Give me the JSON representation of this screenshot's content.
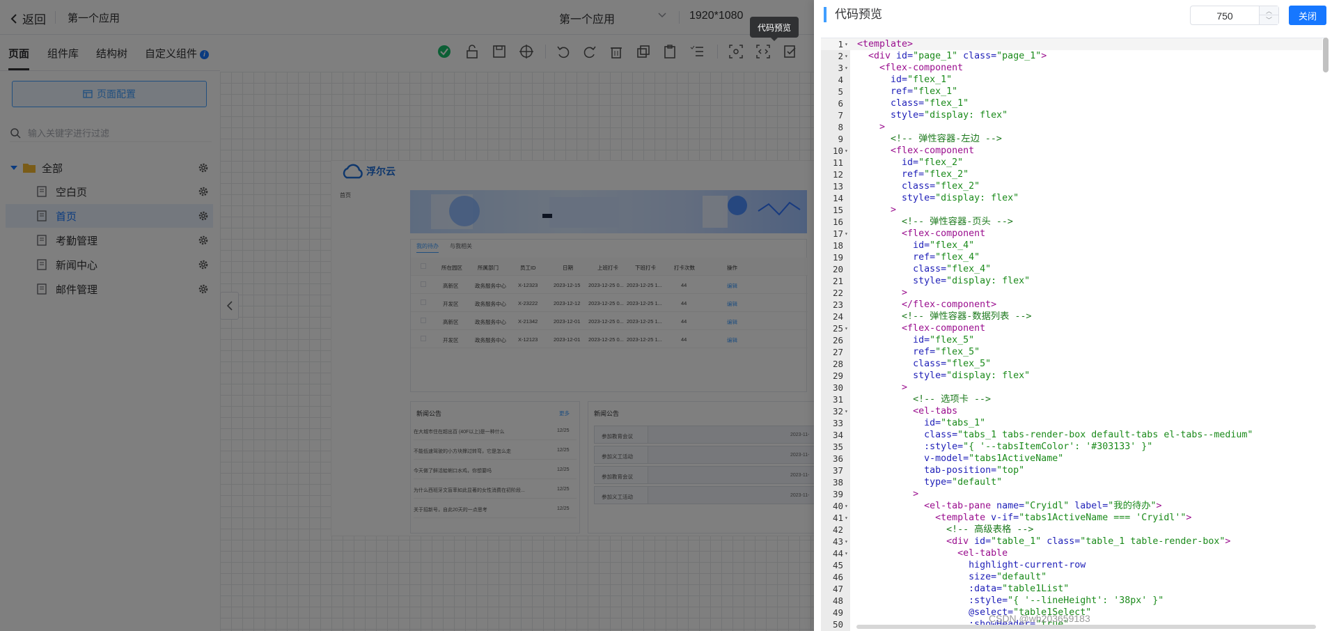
{
  "topbar": {
    "back_label": "返回",
    "app_name": "第一个应用",
    "center_app_select": "第一个应用",
    "resolution": "1920*1080"
  },
  "left_tabs": [
    "页面",
    "组件库",
    "结构树",
    "自定义组件"
  ],
  "left_panel": {
    "page_config_label": "页面配置",
    "filter_placeholder": "输入关键字进行过滤",
    "tree_root": "全部",
    "tree_items": [
      "空白页",
      "首页",
      "考勤管理",
      "新闻中心",
      "邮件管理"
    ],
    "active_item": "首页"
  },
  "tooltip": "代码预览",
  "preview": {
    "logo": "浮尔云",
    "home_label": "首页",
    "tabs": [
      "我的待办",
      "与我相关"
    ],
    "table_headers": [
      "所在园区",
      "所属部门",
      "员工ID",
      "日期",
      "上班打卡",
      "下班打卡",
      "打卡次数",
      "操作"
    ],
    "table_rows": [
      [
        "高新区",
        "政务服务中心",
        "X-12323",
        "2023-12-15",
        "2023-12-25 0...",
        "2023-12-25 1...",
        "44",
        "编辑"
      ],
      [
        "开发区",
        "政务服务中心",
        "X-23222",
        "2023-12-12",
        "2023-12-25 0...",
        "2023-12-25 1...",
        "44",
        "编辑"
      ],
      [
        "高新区",
        "政务服务中心",
        "X-21342",
        "2023-12-01",
        "2023-12-25 0...",
        "2023-12-25 1...",
        "44",
        "编辑"
      ],
      [
        "开发区",
        "政务服务中心",
        "X-12123",
        "2023-12-01",
        "2023-12-25 0...",
        "2023-12-25 1...",
        "44",
        "编辑"
      ]
    ],
    "news_title": "新闻公告",
    "news_more": "更多",
    "news_items": [
      [
        "在大城市住在超出百 (40F以上)是一种什么",
        "12/25"
      ],
      [
        "不能低速驾驶的小方块撑过转弯，它是怎么走",
        "12/25"
      ],
      [
        "今天做了鲜活蛤蜊口水鸡，你想要吗",
        "12/25"
      ],
      [
        "为什么西班牙文盲率如此显著的女性消费在初阶段...",
        "12/25"
      ],
      [
        "关于招新号，自此20天的一点思考",
        "12/25"
      ]
    ],
    "news2_title": "新闻公告",
    "news2_items": [
      "参加教育会议",
      "参加义工活动",
      "参加教育会议",
      "参加义工活动"
    ],
    "news2_date": "2023-11-"
  },
  "drawer": {
    "title": "代码预览",
    "width_value": "750",
    "close_label": "关闭"
  },
  "code_lines": [
    [
      [
        "tag",
        "<template>"
      ]
    ],
    [
      [
        "txt",
        "  "
      ],
      [
        "tag",
        "<div"
      ],
      [
        "attr",
        " id="
      ],
      [
        "str",
        "\"page_1\""
      ],
      [
        "attr",
        " class="
      ],
      [
        "str",
        "\"page_1\""
      ],
      [
        "tag",
        ">"
      ]
    ],
    [
      [
        "txt",
        "    "
      ],
      [
        "tag",
        "<flex-component"
      ]
    ],
    [
      [
        "txt",
        "      "
      ],
      [
        "attr",
        "id="
      ],
      [
        "str",
        "\"flex_1\""
      ]
    ],
    [
      [
        "txt",
        "      "
      ],
      [
        "attr",
        "ref="
      ],
      [
        "str",
        "\"flex_1\""
      ]
    ],
    [
      [
        "txt",
        "      "
      ],
      [
        "attr",
        "class="
      ],
      [
        "str",
        "\"flex_1\""
      ]
    ],
    [
      [
        "txt",
        "      "
      ],
      [
        "attr",
        "style="
      ],
      [
        "str",
        "\"display: flex\""
      ]
    ],
    [
      [
        "txt",
        "    "
      ],
      [
        "tag",
        ">"
      ]
    ],
    [
      [
        "txt",
        "      "
      ],
      [
        "com",
        "<!-- 弹性容器-左边 -->"
      ]
    ],
    [
      [
        "txt",
        "      "
      ],
      [
        "tag",
        "<flex-component"
      ]
    ],
    [
      [
        "txt",
        "        "
      ],
      [
        "attr",
        "id="
      ],
      [
        "str",
        "\"flex_2\""
      ]
    ],
    [
      [
        "txt",
        "        "
      ],
      [
        "attr",
        "ref="
      ],
      [
        "str",
        "\"flex_2\""
      ]
    ],
    [
      [
        "txt",
        "        "
      ],
      [
        "attr",
        "class="
      ],
      [
        "str",
        "\"flex_2\""
      ]
    ],
    [
      [
        "txt",
        "        "
      ],
      [
        "attr",
        "style="
      ],
      [
        "str",
        "\"display: flex\""
      ]
    ],
    [
      [
        "txt",
        "      "
      ],
      [
        "tag",
        ">"
      ]
    ],
    [
      [
        "txt",
        "        "
      ],
      [
        "com",
        "<!-- 弹性容器-页头 -->"
      ]
    ],
    [
      [
        "txt",
        "        "
      ],
      [
        "tag",
        "<flex-component"
      ]
    ],
    [
      [
        "txt",
        "          "
      ],
      [
        "attr",
        "id="
      ],
      [
        "str",
        "\"flex_4\""
      ]
    ],
    [
      [
        "txt",
        "          "
      ],
      [
        "attr",
        "ref="
      ],
      [
        "str",
        "\"flex_4\""
      ]
    ],
    [
      [
        "txt",
        "          "
      ],
      [
        "attr",
        "class="
      ],
      [
        "str",
        "\"flex_4\""
      ]
    ],
    [
      [
        "txt",
        "          "
      ],
      [
        "attr",
        "style="
      ],
      [
        "str",
        "\"display: flex\""
      ]
    ],
    [
      [
        "txt",
        "        "
      ],
      [
        "tag",
        ">"
      ]
    ],
    [
      [
        "txt",
        "        "
      ],
      [
        "tag",
        "</flex-component>"
      ]
    ],
    [
      [
        "txt",
        "        "
      ],
      [
        "com",
        "<!-- 弹性容器-数据列表 -->"
      ]
    ],
    [
      [
        "txt",
        "        "
      ],
      [
        "tag",
        "<flex-component"
      ]
    ],
    [
      [
        "txt",
        "          "
      ],
      [
        "attr",
        "id="
      ],
      [
        "str",
        "\"flex_5\""
      ]
    ],
    [
      [
        "txt",
        "          "
      ],
      [
        "attr",
        "ref="
      ],
      [
        "str",
        "\"flex_5\""
      ]
    ],
    [
      [
        "txt",
        "          "
      ],
      [
        "attr",
        "class="
      ],
      [
        "str",
        "\"flex_5\""
      ]
    ],
    [
      [
        "txt",
        "          "
      ],
      [
        "attr",
        "style="
      ],
      [
        "str",
        "\"display: flex\""
      ]
    ],
    [
      [
        "txt",
        "        "
      ],
      [
        "tag",
        ">"
      ]
    ],
    [
      [
        "txt",
        "          "
      ],
      [
        "com",
        "<!-- 选项卡 -->"
      ]
    ],
    [
      [
        "txt",
        "          "
      ],
      [
        "tag",
        "<el-tabs"
      ]
    ],
    [
      [
        "txt",
        "            "
      ],
      [
        "attr",
        "id="
      ],
      [
        "str",
        "\"tabs_1\""
      ]
    ],
    [
      [
        "txt",
        "            "
      ],
      [
        "attr",
        "class="
      ],
      [
        "str",
        "\"tabs_1 tabs-render-box default-tabs el-tabs--medium\""
      ]
    ],
    [
      [
        "txt",
        "            "
      ],
      [
        "attr",
        ":style="
      ],
      [
        "str",
        "\"{ '--tabsItemColor': '#303133' }\""
      ]
    ],
    [
      [
        "txt",
        "            "
      ],
      [
        "attr",
        "v-model="
      ],
      [
        "str",
        "\"tabs1ActiveName\""
      ]
    ],
    [
      [
        "txt",
        "            "
      ],
      [
        "attr",
        "tab-position="
      ],
      [
        "str",
        "\"top\""
      ]
    ],
    [
      [
        "txt",
        "            "
      ],
      [
        "attr",
        "type="
      ],
      [
        "str",
        "\"default\""
      ]
    ],
    [
      [
        "txt",
        "          "
      ],
      [
        "tag",
        ">"
      ]
    ],
    [
      [
        "txt",
        "            "
      ],
      [
        "tag",
        "<el-tab-pane"
      ],
      [
        "attr",
        " name="
      ],
      [
        "str",
        "\"Cryidl\""
      ],
      [
        "attr",
        " label="
      ],
      [
        "str",
        "\"我的待办\""
      ],
      [
        "tag",
        ">"
      ]
    ],
    [
      [
        "txt",
        "              "
      ],
      [
        "tag",
        "<template"
      ],
      [
        "attr",
        " v-if="
      ],
      [
        "str",
        "\"tabs1ActiveName === 'Cryidl'\""
      ],
      [
        "tag",
        ">"
      ]
    ],
    [
      [
        "txt",
        "                "
      ],
      [
        "com",
        "<!-- 高级表格 -->"
      ]
    ],
    [
      [
        "txt",
        "                "
      ],
      [
        "tag",
        "<div"
      ],
      [
        "attr",
        " id="
      ],
      [
        "str",
        "\"table_1\""
      ],
      [
        "attr",
        " class="
      ],
      [
        "str",
        "\"table_1 table-render-box\""
      ],
      [
        "tag",
        ">"
      ]
    ],
    [
      [
        "txt",
        "                  "
      ],
      [
        "tag",
        "<el-table"
      ]
    ],
    [
      [
        "txt",
        "                    "
      ],
      [
        "attr",
        "highlight-current-row"
      ]
    ],
    [
      [
        "txt",
        "                    "
      ],
      [
        "attr",
        "size="
      ],
      [
        "str",
        "\"default\""
      ]
    ],
    [
      [
        "txt",
        "                    "
      ],
      [
        "attr",
        ":data="
      ],
      [
        "str",
        "\"table1List\""
      ]
    ],
    [
      [
        "txt",
        "                    "
      ],
      [
        "attr",
        ":style="
      ],
      [
        "str",
        "\"{ '--lineHeight': '38px' }\""
      ]
    ],
    [
      [
        "txt",
        "                    "
      ],
      [
        "attr",
        "@select="
      ],
      [
        "str",
        "\"table1Select\""
      ]
    ],
    [
      [
        "txt",
        "                    "
      ],
      [
        "attr",
        ":showHeader="
      ],
      [
        "str",
        "\"true\""
      ]
    ]
  ],
  "fold_lines": [
    2,
    3,
    10,
    17,
    25,
    32,
    40,
    41,
    43,
    44
  ],
  "watermark": "CSDN @wh203659183"
}
